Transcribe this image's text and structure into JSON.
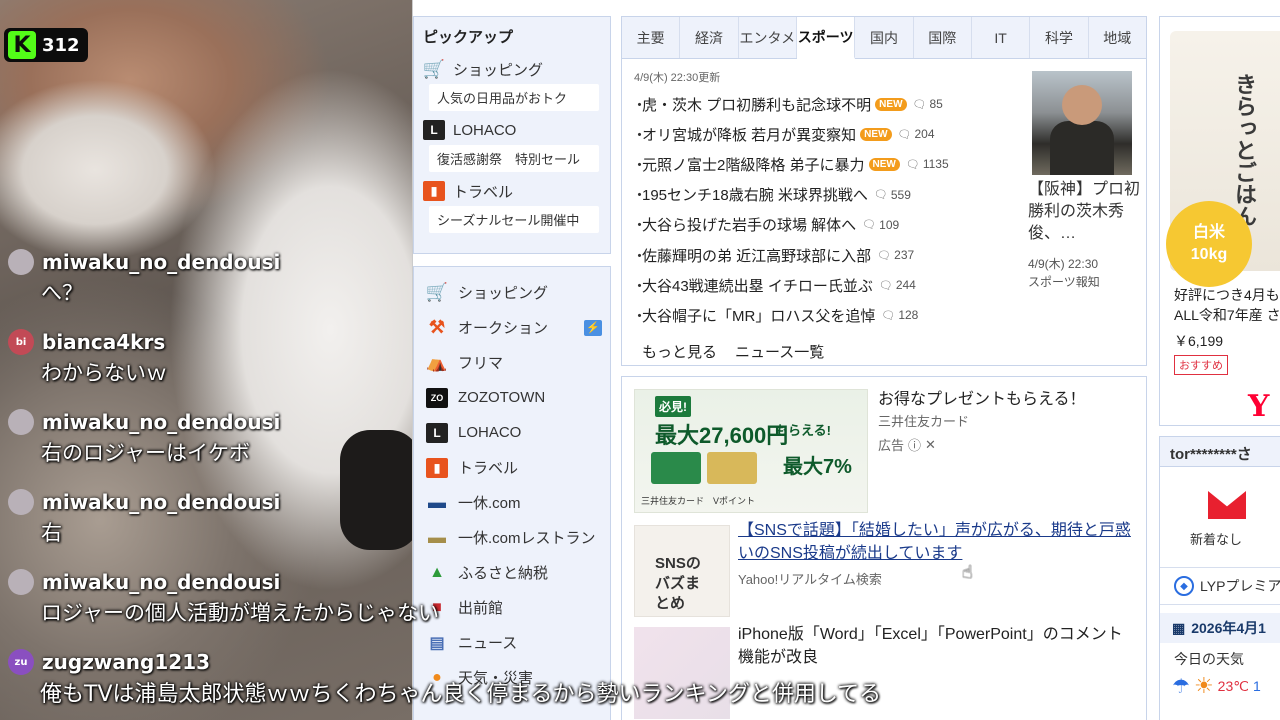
{
  "stream": {
    "viewer_count": "312",
    "kick_letter": "K"
  },
  "chat": [
    {
      "user": "miwaku_no_dendousi",
      "initials": "",
      "color": "#b9b1b8",
      "text": "へ？"
    },
    {
      "user": "bianca4krs",
      "initials": "bi",
      "color": "#c24a56",
      "text": "わからないｗ"
    },
    {
      "user": "miwaku_no_dendousi",
      "initials": "",
      "color": "#b9b1b8",
      "text": "右のロジャーはイケボ"
    },
    {
      "user": "miwaku_no_dendousi",
      "initials": "",
      "color": "#b9b1b8",
      "text": "右"
    },
    {
      "user": "miwaku_no_dendousi",
      "initials": "",
      "color": "#b9b1b8",
      "text": "ロジャーの個人活動が増えたからじゃない"
    },
    {
      "user": "zugzwang1213",
      "initials": "zu",
      "color": "#8a4fc0",
      "text": ""
    }
  ],
  "caption": "俺もTVは浦島太郎状態ｗｗちくわちゃん良く停まるから勢いランキングと併用してる",
  "pickup": {
    "title": "ピックアップ",
    "items": [
      {
        "icon": "shopping-cart-icon",
        "label": "ショッピング",
        "sub": "人気の日用品がおトク"
      },
      {
        "icon": "lohaco-icon",
        "label": "LOHACO",
        "sub": "復活感謝祭　特別セール"
      },
      {
        "icon": "travel-bag-icon",
        "label": "トラベル",
        "sub": "シーズナルセール開催中"
      }
    ]
  },
  "services": [
    {
      "icon": "shopping-cart-icon",
      "label": "ショッピング"
    },
    {
      "icon": "auction-hammer-icon",
      "label": "オークション"
    },
    {
      "icon": "flea-market-icon",
      "label": "フリマ"
    },
    {
      "icon": "zozo-icon",
      "label": "ZOZOTOWN"
    },
    {
      "icon": "lohaco-icon",
      "label": "LOHACO"
    },
    {
      "icon": "travel-bag-icon",
      "label": "トラベル"
    },
    {
      "icon": "ikyu-icon",
      "label": "一休.com"
    },
    {
      "icon": "ikyu-restaurant-icon",
      "label": "一休.comレストラン"
    },
    {
      "icon": "furusato-icon",
      "label": "ふるさと納税"
    },
    {
      "icon": "shutten-icon",
      "label": "出前館"
    },
    {
      "icon": "news-icon",
      "label": "ニュース"
    },
    {
      "icon": "weather-icon",
      "label": "天気・災害"
    }
  ],
  "news": {
    "tabs": [
      "主要",
      "経済",
      "エンタメ",
      "スポーツ",
      "国内",
      "国際",
      "IT",
      "科学",
      "地域"
    ],
    "active_tab": "スポーツ",
    "updated": "4/9(木) 22:30更新",
    "items": [
      {
        "title": "虎・茨木 プロ初勝利も記念球不明",
        "new": "NEW",
        "comments": "85"
      },
      {
        "title": "オリ宮城が降板 若月が異変察知",
        "new": "NEW",
        "comments": "204"
      },
      {
        "title": "元照ノ富士2階級降格 弟子に暴力",
        "new": "NEW",
        "comments": "1135"
      },
      {
        "title": "195センチ18歳右腕 米球界挑戦へ",
        "new": "",
        "comments": "559"
      },
      {
        "title": "大谷ら投げた岩手の球場 解体へ",
        "new": "",
        "comments": "109"
      },
      {
        "title": "佐藤輝明の弟 近江高野球部に入部",
        "new": "",
        "comments": "237"
      },
      {
        "title": "大谷43戦連続出塁 イチロー氏並ぶ",
        "new": "",
        "comments": "244"
      },
      {
        "title": "大谷帽子に「MR」ロハス父を追悼",
        "new": "",
        "comments": "128"
      }
    ],
    "more": "もっと見る",
    "list": "ニュース一覧",
    "feature_title": "【阪神】プロ初勝利の茨木秀俊、…",
    "feature_time": "4/9(木) 22:30",
    "feature_source": "スポーツ報知"
  },
  "ad": {
    "stamp": "必見!",
    "amount": "最大27,600円",
    "amount_sub": "もらえる!",
    "pct": "最大7%",
    "foot": "三井住友カード　Vポイント",
    "title": "お得なプレゼントもらえる！",
    "sponsor": "三井住友カード",
    "label": "広告"
  },
  "articles": [
    {
      "title": "【SNSで話題】「結婚したい」声が広がる、期待と戸惑いのSNS投稿が続出しています",
      "source": "Yahoo!リアルタイム検索",
      "thumb_text": "SNSのバズまとめ"
    },
    {
      "title": "iPhone版「Word」「Excel」「PowerPoint」のコメント機能が改良",
      "source": "",
      "thumb_text": ""
    }
  ],
  "product": {
    "bag_text": "きらっとごはん",
    "circle_top": "白米",
    "circle_bottom": "10kg",
    "desc_line1": "好評につき4月も",
    "desc_line2": "ALL令和7年産 さ",
    "price": "￥6,199",
    "recommend": "おすすめ",
    "brand": "Y"
  },
  "account": {
    "name": "tor********さ",
    "mail": "新着なし",
    "lyp": "LYPプレミア",
    "date": "2026年4月1",
    "weather_label": "今日の天気",
    "temp_hi": "23℃",
    "temp_lo": "1"
  },
  "colors": {
    "accent": "#f39c1c",
    "kick_green": "#53fc18",
    "yahoo_red": "#ff0033"
  }
}
